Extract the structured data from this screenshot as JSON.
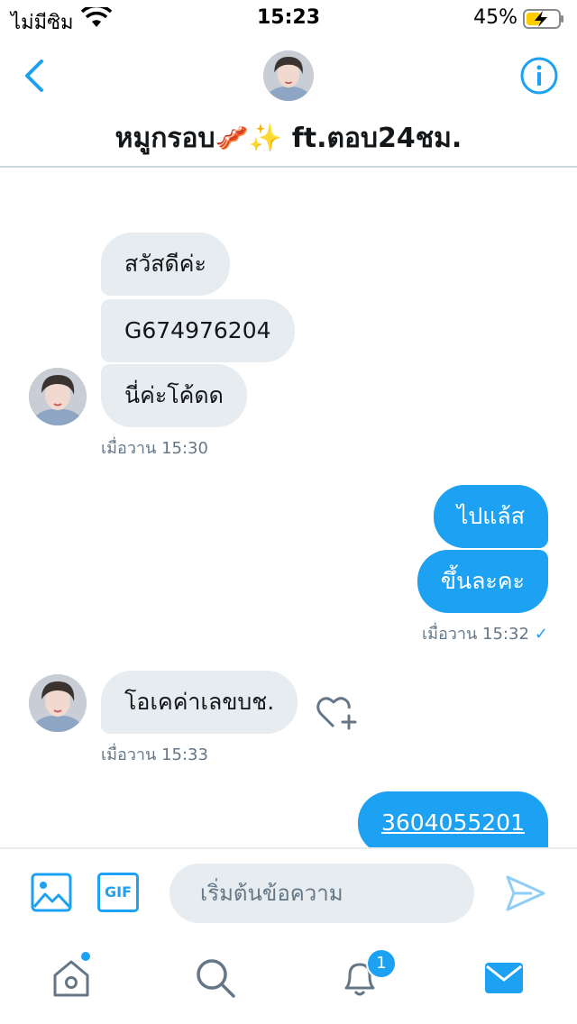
{
  "status_bar": {
    "carrier": "ไม่มีซิม",
    "time": "15:23",
    "battery_percent": "45%",
    "battery_level": 0.45,
    "charging": true
  },
  "header": {
    "title": "หมูกรอบ🥓✨ ft.ตอบ24ชม.",
    "back_icon": "chevron-left-icon",
    "info_icon": "info-circle-icon"
  },
  "messages": [
    {
      "direction": "in",
      "text": "สวัสดีค่ะ"
    },
    {
      "direction": "in",
      "text": "G674976204"
    },
    {
      "direction": "in",
      "text": "นี่ค่ะโค้ดด"
    },
    {
      "direction": "in",
      "timestamp": "เมื่อวาน 15:30"
    },
    {
      "direction": "out",
      "text": "ไปแล้ส"
    },
    {
      "direction": "out",
      "text": "ขึ้นละคะ"
    },
    {
      "direction": "out",
      "timestamp": "เมื่อวาน 15:32",
      "status_icon": "read-check-icon",
      "status_glyph": "✓"
    },
    {
      "direction": "in",
      "text": "โอเคค่าเลขบช."
    },
    {
      "direction": "in",
      "timestamp": "เมื่อวาน 15:33"
    },
    {
      "direction": "out",
      "text": "3604055201",
      "is_link": true
    }
  ],
  "composer": {
    "placeholder": "เริ่มต้นข้อความ",
    "gif_label": "GIF",
    "image_icon": "image-icon",
    "send_icon": "send-icon"
  },
  "tab_bar": {
    "items": [
      {
        "name": "home",
        "icon": "home-icon",
        "has_dot": true
      },
      {
        "name": "search",
        "icon": "search-icon"
      },
      {
        "name": "notifications",
        "icon": "bell-icon",
        "badge": "1"
      },
      {
        "name": "messages",
        "icon": "mail-icon",
        "active": true
      }
    ]
  },
  "colors": {
    "accent": "#1da1f2",
    "incoming_bubble": "#e6ecf0",
    "timestamp": "#657786",
    "text": "#14171a"
  }
}
